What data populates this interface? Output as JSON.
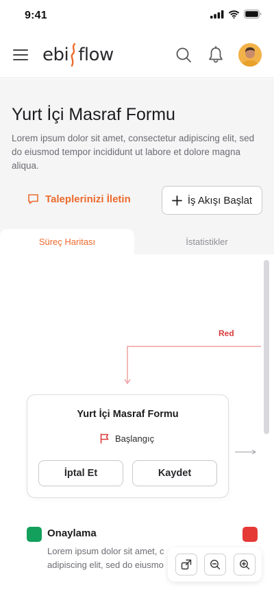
{
  "status_bar": {
    "time": "9:41"
  },
  "header": {
    "logo_text_left": "ebi",
    "logo_text_right": "flow",
    "menu_icon": "hamburger-menu-icon",
    "search_icon": "search-icon",
    "notification_icon": "bell-icon",
    "avatar": "user-avatar"
  },
  "page": {
    "title": "Yurt İçi Masraf Formu",
    "description": "Lorem ipsum dolor sit amet, consectetur adipiscing elit, sed do eiusmod tempor incididunt ut labore et dolore magna aliqua.",
    "requests_label": "Taleplerinizi İletin",
    "start_flow_label": "İş Akışı Başlat"
  },
  "tabs": [
    {
      "label": "Süreç Haritası",
      "active": true
    },
    {
      "label": "İstatistikler",
      "active": false
    }
  ],
  "flow": {
    "edge_label": "Red",
    "node": {
      "title": "Yurt İçi Masraf Formu",
      "status": "Başlangıç",
      "cancel_label": "İptal Et",
      "save_label": "Kaydet"
    },
    "next_step": {
      "title": "Onaylama",
      "description_line1": "Lorem ipsum dolor sit amet, c",
      "description_line2": "adipiscing elit, sed do eiusmo"
    }
  },
  "colors": {
    "accent": "#ec6a2c",
    "reject": "#d93a3a",
    "approve": "#12a05c",
    "flag": "#e53935"
  }
}
